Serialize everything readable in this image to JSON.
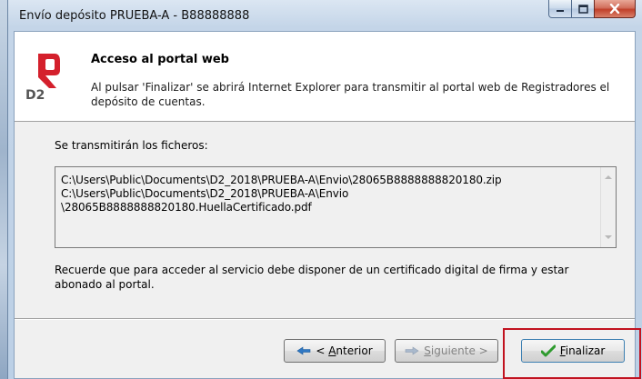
{
  "window": {
    "title": "Envío depósito PRUEBA-A - B88888888"
  },
  "header": {
    "title": "Acceso al portal web",
    "description": "Al pulsar 'Finalizar' se abrirá Internet Explorer para transmitir al portal web de Registradores el depósito de cuentas.",
    "logo_text": "D2"
  },
  "files": {
    "label": "Se transmitirán los ficheros:",
    "content": "C:\\Users\\Public\\Documents\\D2_2018\\PRUEBA-A\\Envio\\28065B8888888820180.zip\nC:\\Users\\Public\\Documents\\D2_2018\\PRUEBA-A\\Envio\n\\28065B8888888820180.HuellaCertificado.pdf"
  },
  "notice": "Recuerde que para acceder al servicio debe disponer de un certificado digital de firma y estar abonado al portal.",
  "buttons": {
    "prev_prefix": "< ",
    "prev_mnemonic": "A",
    "prev_rest": "nterior",
    "next_mnemonic": "S",
    "next_rest": "iguiente >",
    "finish_mnemonic": "F",
    "finish_rest": "inalizar"
  },
  "icons": {
    "prev": "arrow-left-icon",
    "next": "arrow-right-icon",
    "finish": "checkmark-icon",
    "minimize": "minimize-icon",
    "maximize": "maximize-icon",
    "close": "close-icon"
  },
  "colors": {
    "accent_red": "#c1121f",
    "logo_red": "#d4202c",
    "checkmark_green": "#2e9b2e",
    "arrow_blue": "#2f78c4"
  }
}
